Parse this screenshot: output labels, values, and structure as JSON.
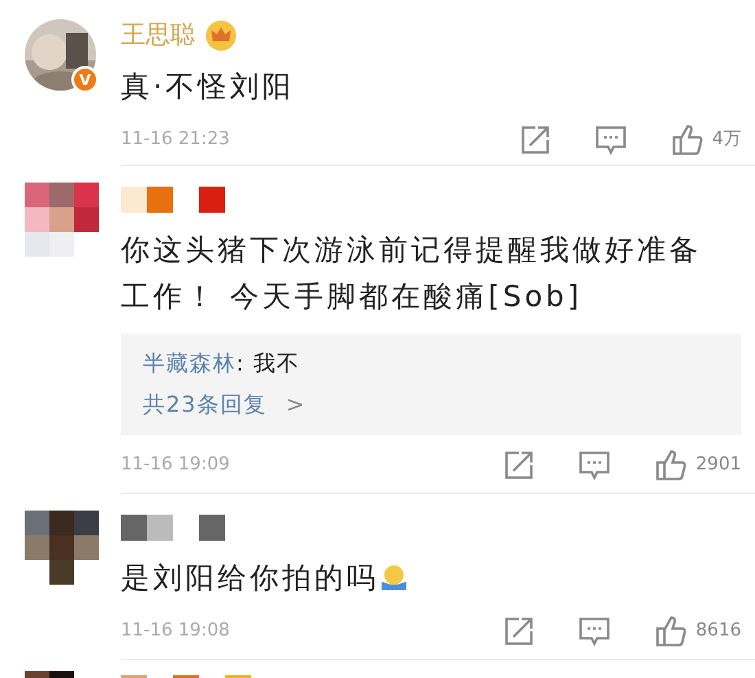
{
  "comments": [
    {
      "verified_badge": "V",
      "name": {
        "kind": "text",
        "text": "王思聪"
      },
      "crown": true,
      "text": "真·不怪刘阳",
      "time": "11-16 21:23",
      "likes": "4万"
    },
    {
      "avatar": {
        "kind": "mosaic"
      },
      "name": {
        "kind": "mosaic"
      },
      "text": "你这头猪下次游泳前记得提醒我做好准备工作！ 今天手脚都在酸痛[Sob]",
      "reply_preview": {
        "author": "半藏森林",
        "text": ": 我不",
        "more": "共23条回复",
        "chevron": ">"
      },
      "time": "11-16 19:09",
      "likes": "2901"
    },
    {
      "avatar": {
        "kind": "mosaic"
      },
      "name": {
        "kind": "mosaic"
      },
      "text": "是刘阳给你拍的吗",
      "emoji": true,
      "time": "11-16 19:08",
      "likes": "8616"
    },
    {
      "avatar": {
        "kind": "mosaic"
      },
      "name": {
        "kind": "mosaic"
      }
    }
  ]
}
